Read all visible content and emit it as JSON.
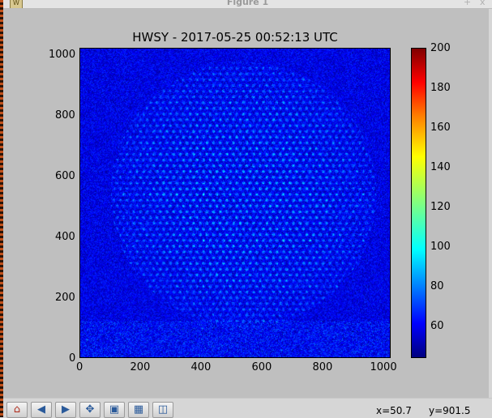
{
  "window": {
    "title": "Figure 1"
  },
  "toolbar": {
    "icons": [
      "home-icon",
      "back-icon",
      "forward-icon",
      "pan-icon",
      "zoom-icon",
      "subplots-icon",
      "save-icon"
    ],
    "coord_x": "x=50.7",
    "coord_y": "y=901.5"
  },
  "chart_data": {
    "type": "heatmap",
    "title": "HWSY - 2017-05-25 00:52:13 UTC",
    "xlim": [
      0,
      1024
    ],
    "ylim": [
      0,
      1024
    ],
    "xticks": [
      "0",
      "200",
      "400",
      "600",
      "800",
      "1000"
    ],
    "yticks": [
      "0",
      "200",
      "400",
      "600",
      "800",
      "1000"
    ],
    "colormap": "jet",
    "clim": [
      44,
      200
    ],
    "colorbar_ticks": [
      "60",
      "80",
      "100",
      "120",
      "140",
      "160",
      "180",
      "200"
    ],
    "background_level": 60,
    "spot_peak_level": 105,
    "spot_pattern": "hexagonal lattice of spots inside a disk",
    "spot_pitch": 22,
    "disk_center": [
      540,
      540
    ],
    "disk_radius": 440
  }
}
